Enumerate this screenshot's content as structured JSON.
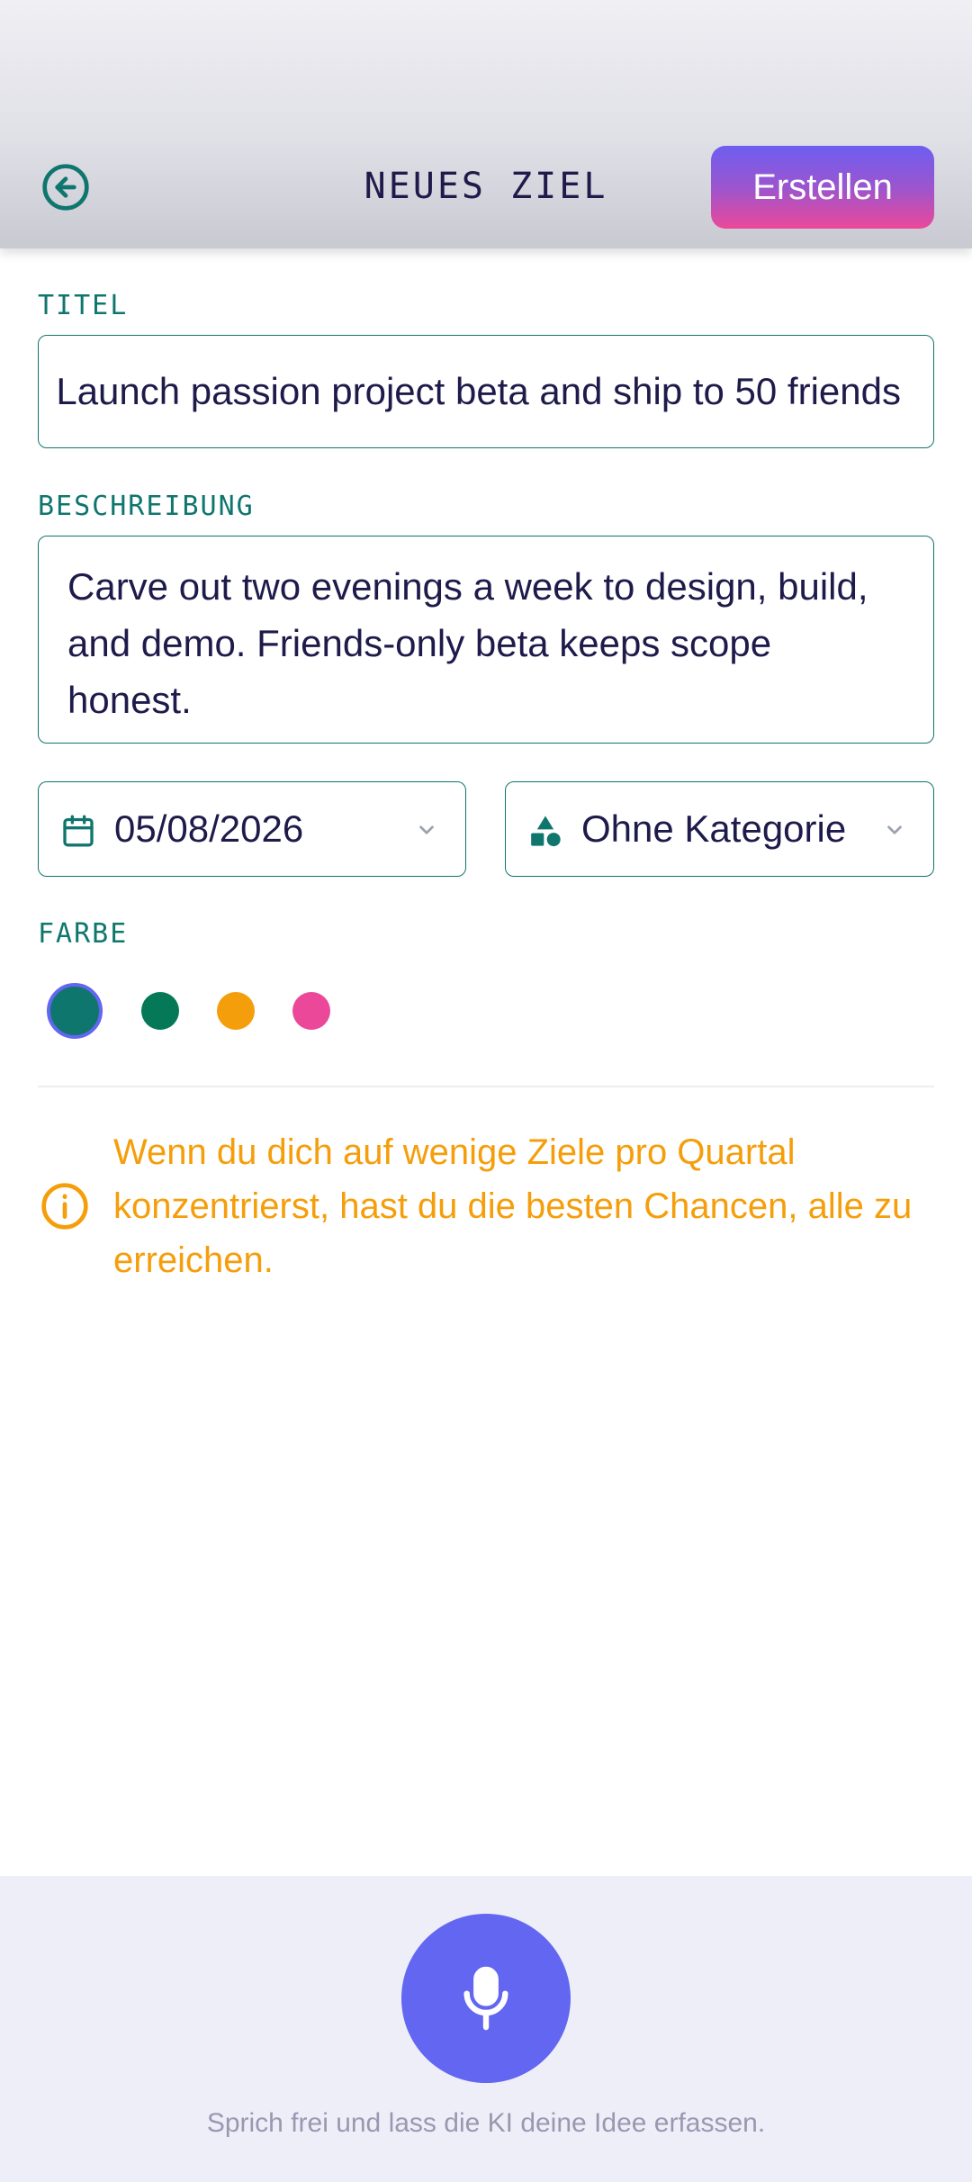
{
  "header": {
    "title": "NEUES ZIEL",
    "create_label": "Erstellen",
    "back_icon": "arrow-left-circle-icon"
  },
  "form": {
    "title_label": "TITEL",
    "title_value": "Launch passion project beta and ship to 50 friends",
    "description_label": "BESCHREIBUNG",
    "description_value": "Carve out two evenings a week to design, build, and demo. Friends-only beta keeps scope honest.",
    "date_value": "05/08/2026",
    "category_value": "Ohne Kategorie",
    "color_label": "FARBE",
    "colors": [
      {
        "name": "teal",
        "hex": "#0f766e",
        "selected": true
      },
      {
        "name": "green",
        "hex": "#047857",
        "selected": false
      },
      {
        "name": "amber",
        "hex": "#f59e0b",
        "selected": false
      },
      {
        "name": "pink",
        "hex": "#ec4899",
        "selected": false
      }
    ]
  },
  "info": {
    "text": "Wenn du dich auf wenige Ziele pro Quartal konzentrierst, hast du die besten Chancen, alle zu erreichen."
  },
  "voice": {
    "hint": "Sprich frei und lass die KI deine Idee erfassen."
  },
  "theme": {
    "accent": "#0f766e",
    "primary": "#6366f1",
    "warning": "#f59e0b"
  }
}
